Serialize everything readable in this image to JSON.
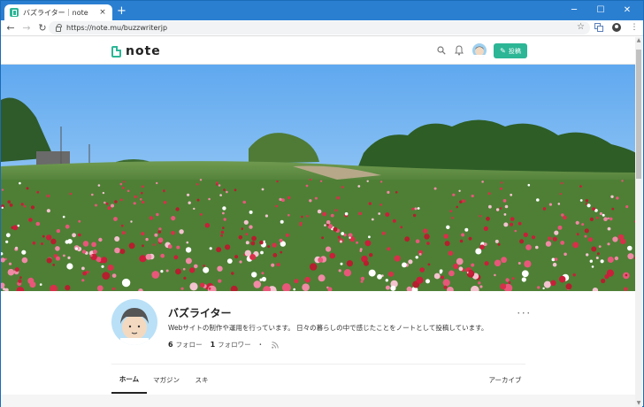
{
  "browser": {
    "tab_title": "バズライター｜note",
    "new_tab": "+",
    "close_tab": "×",
    "url": "https://note.mu/buzzwriterjp",
    "window_controls": {
      "minimize": "─",
      "maximize": "☐",
      "close": "✕"
    }
  },
  "header": {
    "logo_text": "note",
    "post_label": "投稿",
    "accent_color": "#2cb696"
  },
  "profile": {
    "name": "バズライター",
    "bio": "Webサイトの制作や運用を行っています。 日々の暮らしの中で感じたことをノートとして投稿しています。",
    "follow_count": "6",
    "follow_label": "フォロー",
    "follower_count": "1",
    "follower_label": "フォロワー",
    "dot": "・",
    "more": "･･･"
  },
  "tabs": {
    "home": "ホーム",
    "magazine": "マガジン",
    "like": "スキ",
    "archive": "アーカイブ"
  }
}
